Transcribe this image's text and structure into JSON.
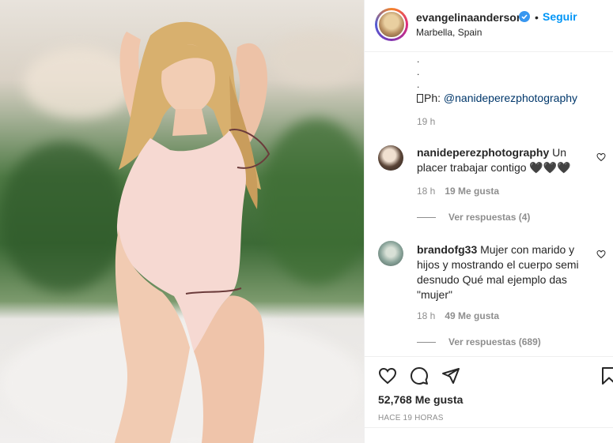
{
  "post": {
    "username": "evangelinaanderson",
    "follow_label": "Seguir",
    "dot": "•",
    "location": "Marbella, Spain",
    "caption_dots": [
      ".",
      ".",
      "."
    ],
    "credit_prefix": "Ph: ",
    "credit_handle": "@nanideperezphotography",
    "caption_age": "19 h",
    "likes": "52,768 Me gusta",
    "posted": "HACE 19 HORAS"
  },
  "comments": [
    {
      "user": "nanideperezphotography",
      "text": " Un placer trabajar contigo 🖤🖤🖤",
      "age": "18 h",
      "likes": "19 Me gusta",
      "replies": "Ver respuestas (4)"
    },
    {
      "user": "brandofg33",
      "text": " Mujer con marido y hijos y mostrando el cuerpo semi desnudo Qué mal ejemplo das \"mujer\"",
      "age": "18 h",
      "likes": "49 Me gusta",
      "replies": "Ver respuestas (689)"
    }
  ],
  "icons": {
    "like": "heart-icon",
    "comment": "comment-icon",
    "share": "share-icon",
    "save": "bookmark-icon",
    "verified": "verified-badge-icon"
  },
  "colors": {
    "accent": "#0095f6",
    "verified": "#3897f0",
    "text": "#262626",
    "muted": "#8e8e8e"
  }
}
